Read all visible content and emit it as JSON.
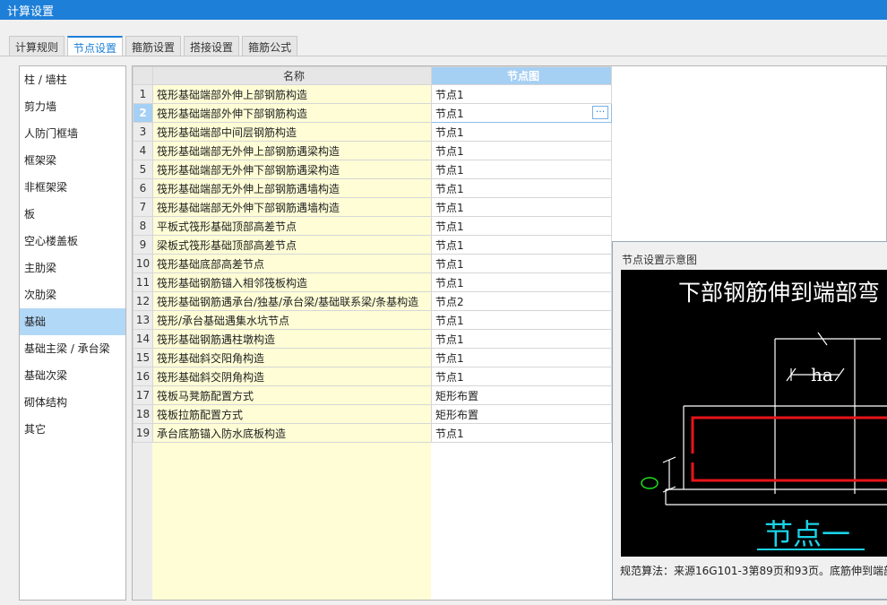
{
  "window": {
    "title": "计算设置"
  },
  "tabs": [
    {
      "label": "计算规则",
      "active": false
    },
    {
      "label": "节点设置",
      "active": true
    },
    {
      "label": "箍筋设置",
      "active": false
    },
    {
      "label": "搭接设置",
      "active": false
    },
    {
      "label": "箍筋公式",
      "active": false
    }
  ],
  "sidebar": {
    "items": [
      {
        "label": "柱 / 墙柱",
        "active": false
      },
      {
        "label": "剪力墙",
        "active": false
      },
      {
        "label": "人防门框墙",
        "active": false
      },
      {
        "label": "框架梁",
        "active": false
      },
      {
        "label": "非框架梁",
        "active": false
      },
      {
        "label": "板",
        "active": false
      },
      {
        "label": "空心楼盖板",
        "active": false
      },
      {
        "label": "主肋梁",
        "active": false
      },
      {
        "label": "次肋梁",
        "active": false
      },
      {
        "label": "基础",
        "active": true
      },
      {
        "label": "基础主梁 / 承台梁",
        "active": false
      },
      {
        "label": "基础次梁",
        "active": false
      },
      {
        "label": "砌体结构",
        "active": false
      },
      {
        "label": "其它",
        "active": false
      }
    ]
  },
  "grid": {
    "columns": {
      "name": "名称",
      "node": "节点图"
    },
    "selected_row": 2,
    "edit_button_label": "···",
    "rows": [
      {
        "num": "1",
        "name": "筏形基础端部外伸上部钢筋构造",
        "node": "节点1"
      },
      {
        "num": "2",
        "name": "筏形基础端部外伸下部钢筋构造",
        "node": "节点1"
      },
      {
        "num": "3",
        "name": "筏形基础端部中间层钢筋构造",
        "node": "节点1"
      },
      {
        "num": "4",
        "name": "筏形基础端部无外伸上部钢筋遇梁构造",
        "node": "节点1"
      },
      {
        "num": "5",
        "name": "筏形基础端部无外伸下部钢筋遇梁构造",
        "node": "节点1"
      },
      {
        "num": "6",
        "name": "筏形基础端部无外伸上部钢筋遇墙构造",
        "node": "节点1"
      },
      {
        "num": "7",
        "name": "筏形基础端部无外伸下部钢筋遇墙构造",
        "node": "节点1"
      },
      {
        "num": "8",
        "name": "平板式筏形基础顶部高差节点",
        "node": "节点1"
      },
      {
        "num": "9",
        "name": "梁板式筏形基础顶部高差节点",
        "node": "节点1"
      },
      {
        "num": "10",
        "name": "筏形基础底部高差节点",
        "node": "节点1"
      },
      {
        "num": "11",
        "name": "筏形基础钢筋锚入相邻筏板构造",
        "node": "节点1"
      },
      {
        "num": "12",
        "name": "筏形基础钢筋遇承台/独基/承台梁/基础联系梁/条基构造",
        "node": "节点2"
      },
      {
        "num": "13",
        "name": "筏形/承台基础遇集水坑节点",
        "node": "节点1"
      },
      {
        "num": "14",
        "name": "筏形基础钢筋遇柱墩构造",
        "node": "节点1"
      },
      {
        "num": "15",
        "name": "筏形基础斜交阳角构造",
        "node": "节点1"
      },
      {
        "num": "16",
        "name": "筏形基础斜交阴角构造",
        "node": "节点1"
      },
      {
        "num": "17",
        "name": "筏板马凳筋配置方式",
        "node": "矩形布置"
      },
      {
        "num": "18",
        "name": "筏板拉筋配置方式",
        "node": "矩形布置"
      },
      {
        "num": "19",
        "name": "承台底筋锚入防水底板构造",
        "node": "节点1"
      }
    ]
  },
  "preview": {
    "title": "节点设置示意图",
    "diagram_heading": "下部钢筋伸到端部弯",
    "dim_label": "ha",
    "node_label": "节点一",
    "caption": "规范算法：来源16G101-3第89页和93页。底筋伸到端部",
    "colors": {
      "background": "#000000",
      "lines": "#ffffff",
      "rebar": "#e8141a",
      "marker": "#1ee01e",
      "node_label": "#1ad2e6"
    }
  }
}
